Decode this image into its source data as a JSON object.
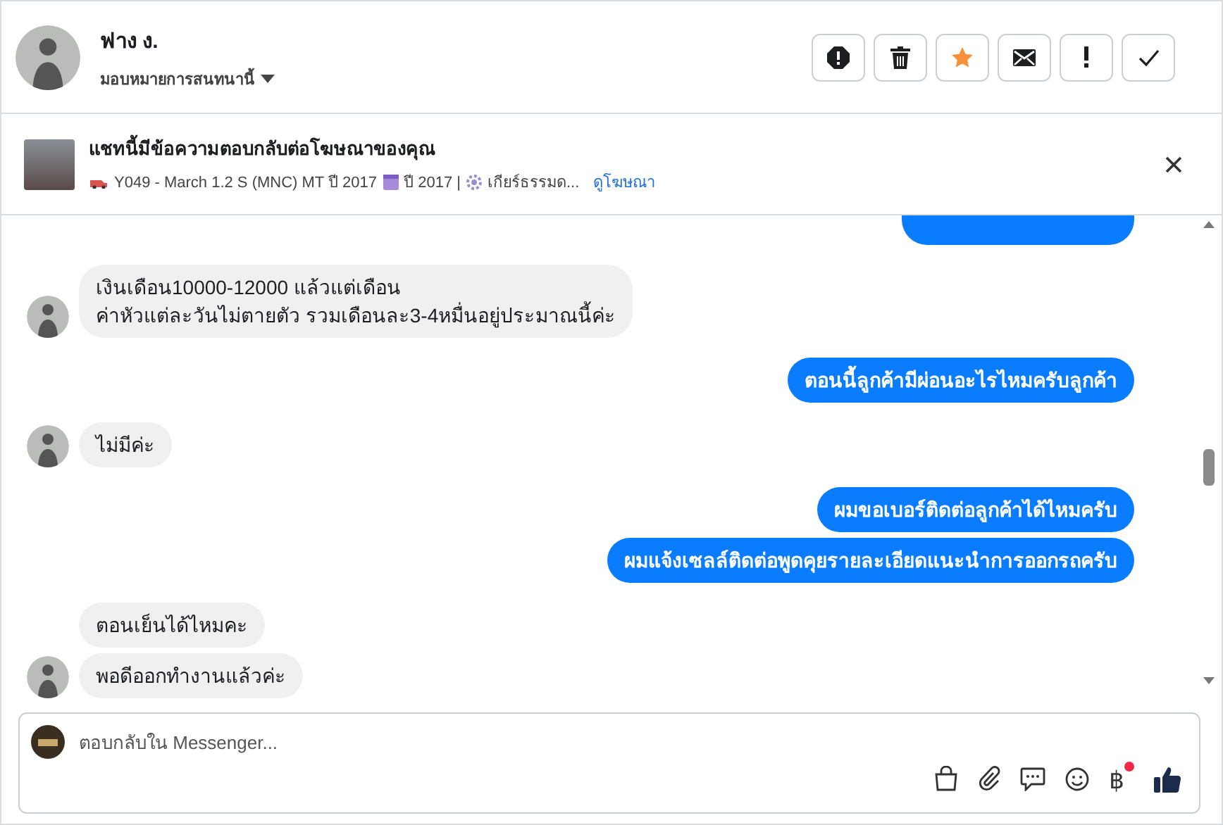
{
  "contact": {
    "name": "ฟาง ง.",
    "assign_label": "มอบหมายการสนทนานี้"
  },
  "toolbar": {
    "buttons": [
      {
        "kind": "spam"
      },
      {
        "kind": "delete"
      },
      {
        "kind": "star",
        "on": true
      },
      {
        "kind": "mail"
      },
      {
        "kind": "important"
      },
      {
        "kind": "done"
      }
    ]
  },
  "ad_banner": {
    "title": "แชทนี้มีข้อความตอบกลับต่อโฆษณาของคุณ",
    "model": "Y049 - March 1.2 S (MNC) MT ปี 2017",
    "year": "ปี 2017 |",
    "gear": "เกียร์ธรรมด...",
    "link": "ดูโฆษณา"
  },
  "messages": [
    {
      "kind": "incoming",
      "avatar": true,
      "lines": [
        "เงินเดือน10000-12000 แล้วแต่เดือน",
        "ค่าหัวแต่ละวันไม่ตายตัว รวมเดือนละ3-4หมื่นอยู่ประมาณนี้ค่ะ"
      ]
    },
    {
      "kind": "outgoing",
      "lines": [
        "ตอนนี้ลูกค้ามีผ่อนอะไรไหมครับลูกค้า"
      ]
    },
    {
      "kind": "incoming",
      "avatar": true,
      "lines": [
        "ไม่มีค่ะ"
      ]
    },
    {
      "kind": "outgoing",
      "lines": [
        "ผมขอเบอร์ติดต่อลูกค้าได้ไหมครับ"
      ]
    },
    {
      "kind": "outgoing",
      "lines": [
        "ผมแจ้งเซลล์ติดต่อพูดคุยรายละเอียดแนะนำการออกรถครับ"
      ]
    },
    {
      "kind": "incoming",
      "avatar": false,
      "lines": [
        "ตอนเย็นได้ไหมคะ"
      ]
    },
    {
      "kind": "incoming",
      "avatar": true,
      "lines": [
        "พอดีออกทำงานแล้วค่ะ"
      ]
    }
  ],
  "composer": {
    "placeholder": "ตอบกลับใน Messenger...",
    "currency_symbol": "฿",
    "currency_notification": true
  }
}
